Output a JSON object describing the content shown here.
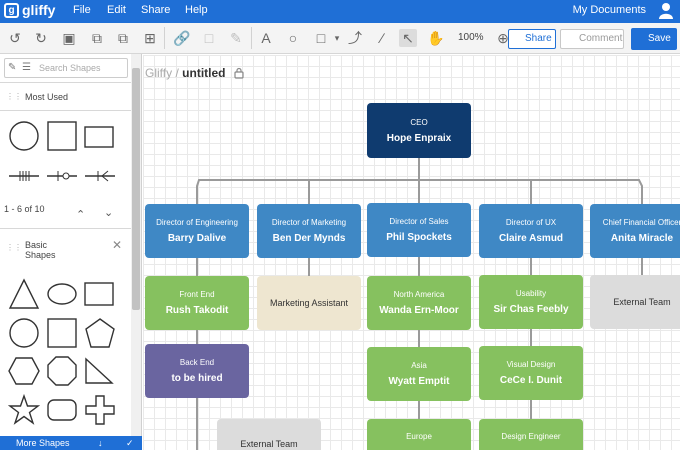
{
  "app": {
    "logo_text": "gliffy",
    "menu": [
      "File",
      "Edit",
      "Share",
      "Help"
    ],
    "my_documents": "My Documents"
  },
  "toolbar": {
    "zoom": "100%",
    "share_label": "Share",
    "comment_label": "Comment",
    "save_label": "Save"
  },
  "sidebar": {
    "search_placeholder": "Search Shapes",
    "section1": "Most Used",
    "pager": "1 - 6 of 10",
    "section2_line1": "Basic",
    "section2_line2": "Shapes",
    "more_shapes": "More Shapes"
  },
  "document": {
    "folder": "Gliffy",
    "separator": "/",
    "title": "untitled"
  },
  "org_chart": {
    "ceo": {
      "role": "CEO",
      "name": "Hope Enpraix"
    },
    "columns": [
      {
        "head": {
          "role": "Director of Engineering",
          "name": "Barry Dalive"
        },
        "children": [
          {
            "role": "Front End",
            "name": "Rush Takodit",
            "style": "green"
          },
          {
            "role": "Back End",
            "name": "to be hired",
            "style": "purple"
          }
        ]
      },
      {
        "head": {
          "role": "Director of Marketing",
          "name": "Ben Der Mynds"
        },
        "children": [
          {
            "role": "Marketing Assistant",
            "name": "",
            "style": "cream"
          }
        ]
      },
      {
        "head": {
          "role": "Director of Sales",
          "name": "Phil Spockets"
        },
        "children": [
          {
            "role": "North America",
            "name": "Wanda Ern-Moor",
            "style": "green"
          },
          {
            "role": "Asia",
            "name": "Wyatt Emptit",
            "style": "green"
          },
          {
            "role": "Europe",
            "name": "",
            "style": "green"
          }
        ]
      },
      {
        "head": {
          "role": "Director of UX",
          "name": "Claire Asmud"
        },
        "children": [
          {
            "role": "Usability",
            "name": "Sir Chas Feebly",
            "style": "green"
          },
          {
            "role": "Visual Design",
            "name": "CeCe I. Dunit",
            "style": "green"
          },
          {
            "role": "Design Engineer",
            "name": "",
            "style": "green"
          }
        ]
      },
      {
        "head": {
          "role": "Chief Financial Officer",
          "name": "Anita Miracle"
        },
        "children": [
          {
            "role": "External Team",
            "name": "",
            "style": "grey"
          }
        ]
      }
    ],
    "extra": {
      "role": "External Team",
      "name": "",
      "style": "grey"
    }
  }
}
